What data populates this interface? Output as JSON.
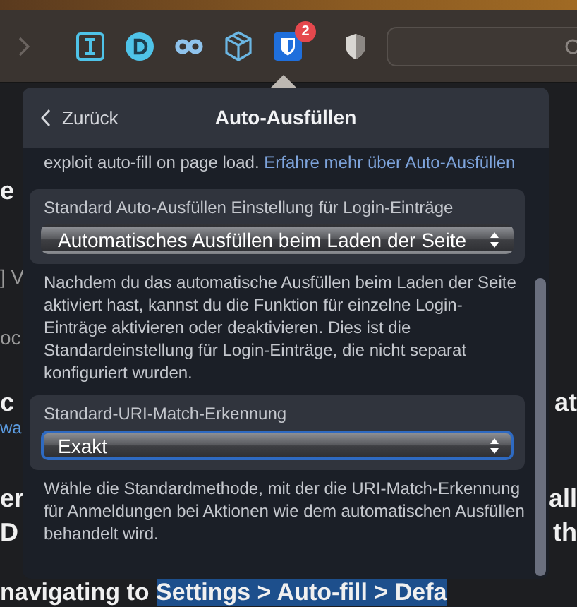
{
  "toolbar": {
    "badge": "2"
  },
  "background": {
    "rows": [
      {
        "left": {
          "text": "e",
          "kind": "heading"
        }
      },
      {
        "left": {
          "text": "] V",
          "kind": "text"
        }
      },
      {
        "left": {
          "text": "oc",
          "kind": "text"
        }
      },
      {
        "left": {
          "text": "c",
          "kind": "heading"
        },
        "right": {
          "text": "at",
          "kind": "heading"
        }
      },
      {
        "left": {
          "text": "wa",
          "kind": "link"
        }
      },
      {
        "left": {
          "text": "er",
          "kind": "heading"
        },
        "right": {
          "text": "all",
          "kind": "heading"
        }
      },
      {
        "left": {
          "text": "D",
          "kind": "heading"
        },
        "right": {
          "text": "th",
          "kind": "heading"
        }
      }
    ],
    "footer": {
      "text": "navigating to ",
      "highlight": "Settings > Auto-fill > Defa"
    }
  },
  "popup": {
    "back_label": "Zurück",
    "title": "Auto-Ausfüllen",
    "intro": {
      "text": "exploit auto-fill on page load. ",
      "link": "Erfahre mehr über Auto-Ausfüllen"
    },
    "settings": [
      {
        "label": "Standard Auto-Ausfüllen Einstellung für Login-Einträge",
        "value": "Automatisches Ausfüllen beim Laden der Seite",
        "focused": false,
        "description": "Nachdem du das automatische Ausfüllen beim Laden der Seite aktiviert hast, kannst du die Funktion für einzelne Login-Einträge aktivieren oder deaktivieren. Dies ist die Standardeinstellung für Login-Einträge, die nicht separat konfiguriert wurden."
      },
      {
        "label": "Standard-URI-Match-Erkennung",
        "value": "Exakt",
        "focused": true,
        "description": "Wähle die Standardmethode, mit der die URI-Match-Erkennung für Anmeldungen bei Aktionen wie dem automatischen Ausfüllen behandelt wird."
      }
    ]
  }
}
